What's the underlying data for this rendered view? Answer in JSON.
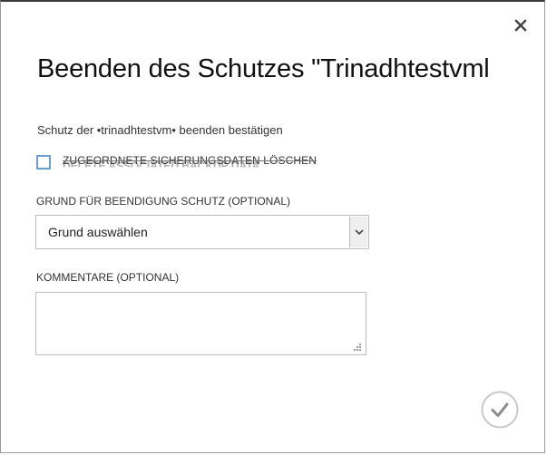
{
  "dialog": {
    "title": "Beenden des Schutzes \"Trinadhtestvml",
    "confirm_text": "Schutz der •trinadhtestvm• beenden bestätigen",
    "delete_backup_label": "ZUGEORDNETE SICHERUNGSDATEN LÖSCHEN",
    "delete_backup_ghost_label": "DELETE ASSOCIATED BACKUP DATA",
    "reason_label": "GRUND FÜR BEENDIGUNG SCHUTZ (OPTIONAL)",
    "reason_selected": "Grund auswählen",
    "comments_label": "KOMMENTARE (OPTIONAL)",
    "comments_value": ""
  },
  "icons": {
    "close": "close-icon",
    "dropdown": "chevron-down-icon",
    "confirm": "checkmark-circle-icon",
    "resize": "resize-grip-icon"
  },
  "colors": {
    "checkbox_border": "#6a9fce",
    "ok_circle": "#c8c8c8",
    "ok_check": "#8a8a8a"
  }
}
